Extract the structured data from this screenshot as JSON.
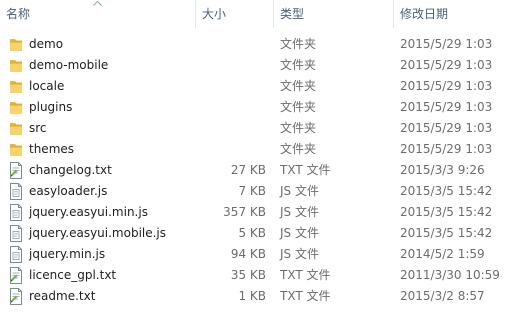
{
  "columns": {
    "name": "名称",
    "size": "大小",
    "type": "类型",
    "date": "修改日期"
  },
  "files": [
    {
      "name": "demo",
      "size": "",
      "type": "文件夹",
      "date": "2015/5/29 1:03",
      "icon": "folder-icon"
    },
    {
      "name": "demo-mobile",
      "size": "",
      "type": "文件夹",
      "date": "2015/5/29 1:03",
      "icon": "folder-icon"
    },
    {
      "name": "locale",
      "size": "",
      "type": "文件夹",
      "date": "2015/5/29 1:03",
      "icon": "folder-icon"
    },
    {
      "name": "plugins",
      "size": "",
      "type": "文件夹",
      "date": "2015/5/29 1:03",
      "icon": "folder-icon"
    },
    {
      "name": "src",
      "size": "",
      "type": "文件夹",
      "date": "2015/5/29 1:03",
      "icon": "folder-icon"
    },
    {
      "name": "themes",
      "size": "",
      "type": "文件夹",
      "date": "2015/5/29 1:03",
      "icon": "folder-icon"
    },
    {
      "name": "changelog.txt",
      "size": "27 KB",
      "type": "TXT 文件",
      "date": "2015/3/3 9:26",
      "icon": "text-file-icon"
    },
    {
      "name": "easyloader.js",
      "size": "7 KB",
      "type": "JS 文件",
      "date": "2015/3/5 15:42",
      "icon": "js-file-icon"
    },
    {
      "name": "jquery.easyui.min.js",
      "size": "357 KB",
      "type": "JS 文件",
      "date": "2015/3/5 15:42",
      "icon": "js-file-icon"
    },
    {
      "name": "jquery.easyui.mobile.js",
      "size": "5 KB",
      "type": "JS 文件",
      "date": "2015/3/5 15:42",
      "icon": "js-file-icon"
    },
    {
      "name": "jquery.min.js",
      "size": "94 KB",
      "type": "JS 文件",
      "date": "2014/5/2 1:59",
      "icon": "js-file-icon"
    },
    {
      "name": "licence_gpl.txt",
      "size": "35 KB",
      "type": "TXT 文件",
      "date": "2011/3/30 10:59",
      "icon": "text-file-icon"
    },
    {
      "name": "readme.txt",
      "size": "1 KB",
      "type": "TXT 文件",
      "date": "2015/3/2 8:57",
      "icon": "text-file-icon"
    }
  ]
}
